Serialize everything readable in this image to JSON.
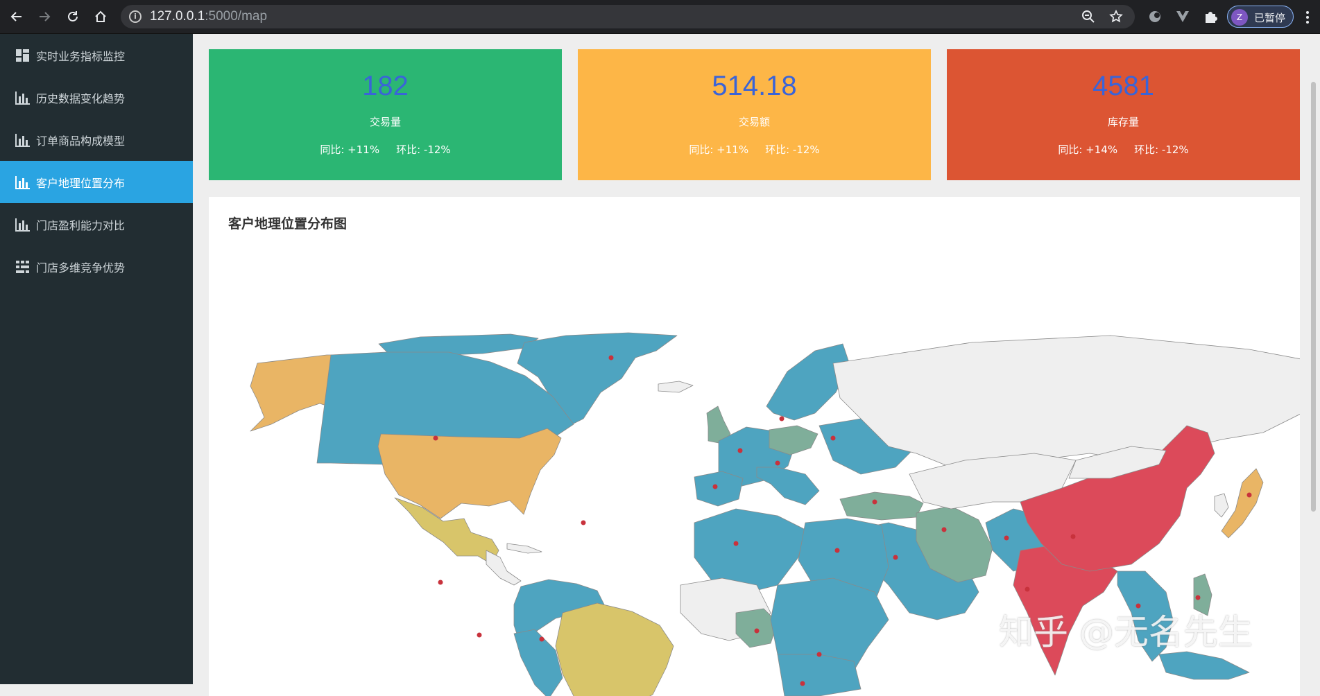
{
  "browser": {
    "url_host": "127.0.0.1",
    "url_path": ":5000/map",
    "profile_initial": "Z",
    "profile_status": "已暂停"
  },
  "sidebar": {
    "items": [
      {
        "label": "实时业务指标监控",
        "icon": "dashboard-icon",
        "active": false
      },
      {
        "label": "历史数据变化趋势",
        "icon": "bar-chart-icon",
        "active": false
      },
      {
        "label": "订单商品构成模型",
        "icon": "bar-chart-icon",
        "active": false
      },
      {
        "label": "客户地理位置分布",
        "icon": "bar-chart-icon",
        "active": true
      },
      {
        "label": "门店盈利能力对比",
        "icon": "bar-chart-icon",
        "active": false
      },
      {
        "label": "门店多维竞争优势",
        "icon": "grid-icon",
        "active": false
      }
    ]
  },
  "cards": [
    {
      "value": "182",
      "label": "交易量",
      "yoy": "同比: +11%",
      "mom": "环比: -12%",
      "color": "#2bb673"
    },
    {
      "value": "514.18",
      "label": "交易额",
      "yoy": "同比: +11%",
      "mom": "环比: -12%",
      "color": "#fdb647"
    },
    {
      "value": "4581",
      "label": "库存量",
      "yoy": "同比: +14%",
      "mom": "环比: -12%",
      "color": "#dc5533"
    }
  ],
  "map_panel": {
    "title": "客户地理位置分布图"
  },
  "map_colors": {
    "blue": "#4ea4c0",
    "gold": "#e9b565",
    "khaki": "#d8c56a",
    "teal": "#7fae9a",
    "red": "#dc4a5a",
    "none": "#efefef"
  },
  "watermark": "知乎 @无名先生"
}
